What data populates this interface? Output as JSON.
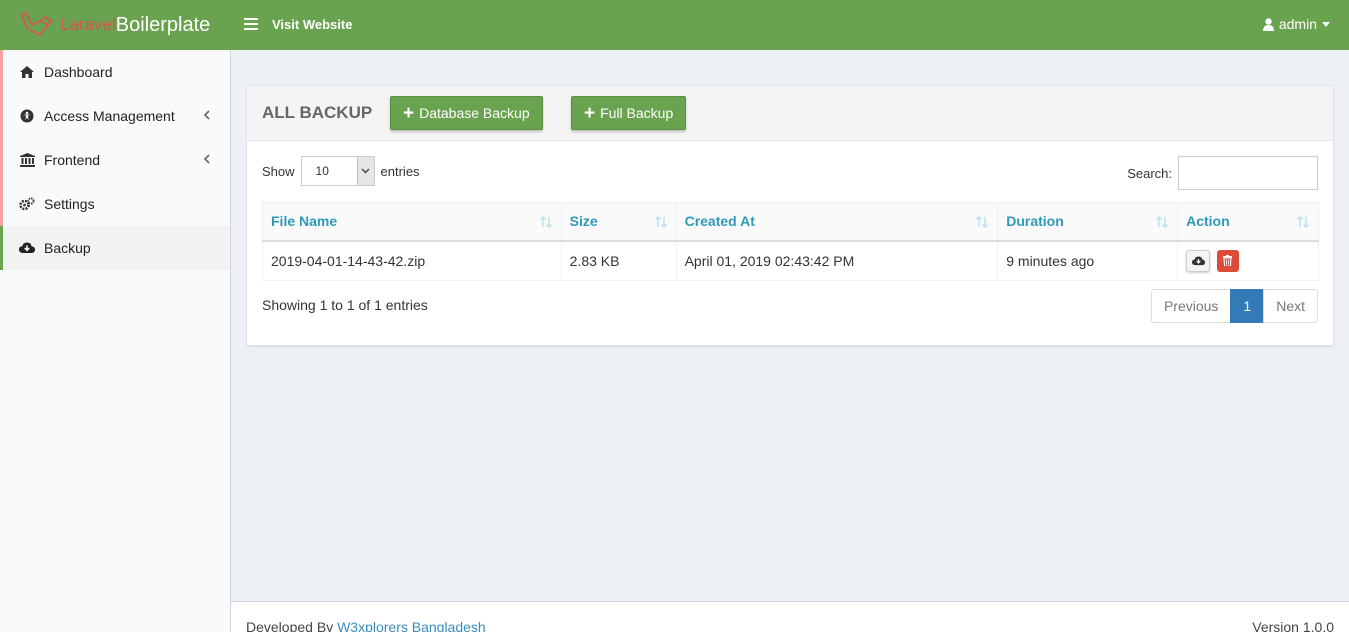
{
  "header": {
    "brand_part1": "Laravel",
    "brand_part2": "Boilerplate",
    "visit_link": "Visit Website",
    "user": "admin",
    "bg_color": "#6aa34f"
  },
  "sidebar": {
    "items": [
      {
        "label": "Dashboard",
        "icon": "home-icon"
      },
      {
        "label": "Access Management",
        "icon": "universal-access-icon"
      },
      {
        "label": "Frontend",
        "icon": "institution-icon"
      },
      {
        "label": "Settings",
        "icon": "cogs-icon"
      },
      {
        "label": "Backup",
        "icon": "cloud-download-icon"
      }
    ]
  },
  "box": {
    "title": "ALL BACKUP",
    "db_backup_label": "Database Backup",
    "full_backup_label": "Full Backup",
    "show_label": "Show",
    "entries_label": "entries",
    "page_length": "10",
    "search_label": "Search:"
  },
  "table": {
    "columns": [
      "File Name",
      "Size",
      "Created At",
      "Duration",
      "Action"
    ],
    "rows": [
      {
        "file_name": "2019-04-01-14-43-42.zip",
        "size": "2.83 KB",
        "created_at": "April 01, 2019 02:43:42 PM",
        "duration": "9 minutes ago"
      }
    ]
  },
  "pagination": {
    "info": "Showing 1 to 1 of 1 entries",
    "previous": "Previous",
    "current": "1",
    "next": "Next"
  },
  "footer": {
    "developed_by": "Developed By",
    "company": "W3xplorers Bangladesh",
    "version": "Version 1.0.0"
  }
}
